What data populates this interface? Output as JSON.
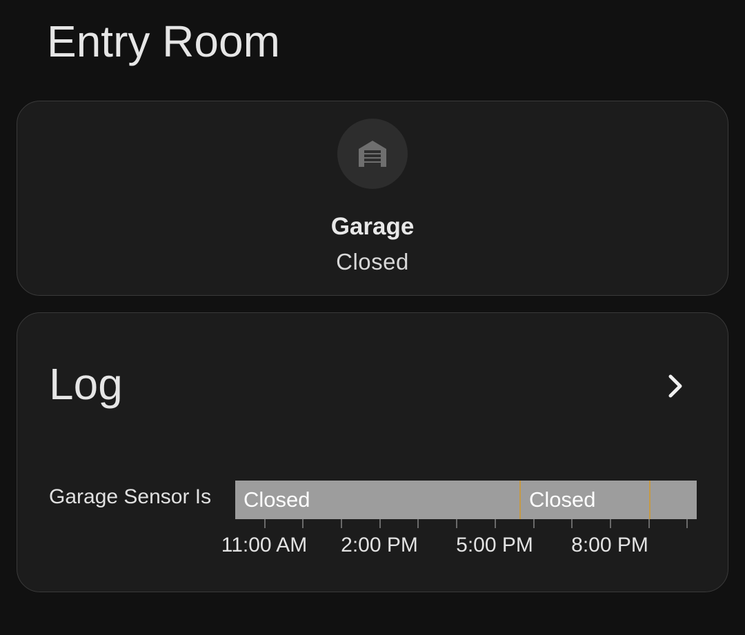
{
  "page": {
    "title": "Entry Room"
  },
  "tile": {
    "icon": "garage-icon",
    "name": "Garage",
    "state": "Closed"
  },
  "log": {
    "title": "Log",
    "more_icon": "chevron-right-icon",
    "row_label": "Garage Sensor Is",
    "segments": [
      {
        "label": "Closed"
      },
      {
        "label": "Closed"
      },
      {
        "label": ""
      }
    ],
    "axis_labels": [
      "11:00 AM",
      "2:00 PM",
      "5:00 PM",
      "8:00 PM"
    ],
    "colors": {
      "bar": "#9d9d9d",
      "divider": "#c59a46",
      "card": "#1c1c1c",
      "background": "#111111"
    }
  }
}
